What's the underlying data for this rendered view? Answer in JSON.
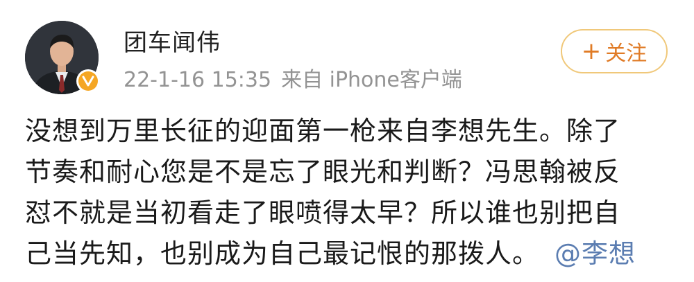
{
  "post": {
    "author": {
      "name": "团车闻伟",
      "verified": true,
      "badge_color": "#f5a623"
    },
    "meta": {
      "date": "22-1-16 15:35",
      "source": "来自 iPhone客户端"
    },
    "follow_button": {
      "label": "关注",
      "icon": "plus-icon",
      "border_color": "#f0c87a",
      "text_color": "#e07b26"
    },
    "content": {
      "lines": [
        "没想到万里长征的迎面第一枪来自李想先生。除了",
        "节奏和耐心您是不是忘了眼光和判断？冯思翰被反",
        "怼不就是当初看走了眼喷得太早？所以谁也别把自",
        "己当先知，也别成为自己最记恨的那拨人。"
      ],
      "mention": "@李想",
      "mention_color": "#5b7db1"
    }
  }
}
